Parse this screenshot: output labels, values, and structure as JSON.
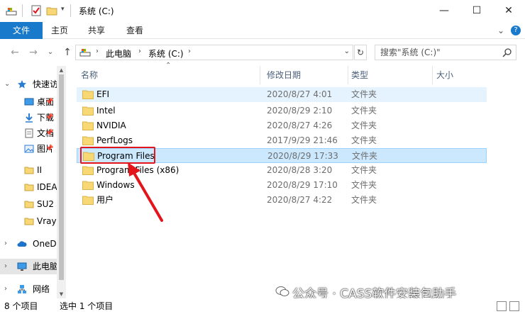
{
  "titlebar": {
    "title": "系统 (C:)",
    "minimize": "—",
    "maximize": "☐",
    "close": "✕"
  },
  "ribbon": {
    "tabs": [
      "文件",
      "主页",
      "共享",
      "查看"
    ],
    "collapse": "⌄",
    "help": "?"
  },
  "address": {
    "back": "←",
    "forward": "→",
    "recent": "⌄",
    "up": "↑",
    "segments": [
      "此电脑",
      "系统 (C:)"
    ],
    "refresh": "↻",
    "search_placeholder": "搜索\"系统 (C:)\""
  },
  "nav": {
    "items": [
      {
        "label": "快速访问",
        "chev": "⌄"
      },
      {
        "label": "桌面"
      },
      {
        "label": "下载"
      },
      {
        "label": "文档"
      },
      {
        "label": "图片"
      },
      {
        "label": "II"
      },
      {
        "label": "IDEA"
      },
      {
        "label": "SU2"
      },
      {
        "label": "Vray"
      },
      {
        "label": "OneDrive",
        "chev": "›"
      },
      {
        "label": "此电脑",
        "chev": "›"
      },
      {
        "label": "网络",
        "chev": "›"
      }
    ]
  },
  "columns": {
    "name": "名称",
    "date": "修改日期",
    "type": "类型",
    "size": "大小"
  },
  "files": [
    {
      "name": "EFI",
      "date": "2020/8/27 4:01",
      "type": "文件夹"
    },
    {
      "name": "Intel",
      "date": "2020/8/29 2:10",
      "type": "文件夹"
    },
    {
      "name": "NVIDIA",
      "date": "2020/8/27 4:26",
      "type": "文件夹"
    },
    {
      "name": "PerfLogs",
      "date": "2017/9/29 21:46",
      "type": "文件夹"
    },
    {
      "name": "Program Files",
      "date": "2020/8/29 17:33",
      "type": "文件夹"
    },
    {
      "name": "Program Files (x86)",
      "date": "2020/8/28 3:20",
      "type": "文件夹"
    },
    {
      "name": "Windows",
      "date": "2020/8/29 17:10",
      "type": "文件夹"
    },
    {
      "name": "用户",
      "date": "2020/8/27 4:22",
      "type": "文件夹"
    }
  ],
  "status": {
    "count": "8 个项目",
    "selected": "选中 1 个项目"
  },
  "watermark": "公众号 · CASS软件安装包助手",
  "colors": {
    "accent": "#1979ca",
    "selection": "#cce8ff",
    "highlight": "#e4141b",
    "folder": "#f8d775"
  }
}
